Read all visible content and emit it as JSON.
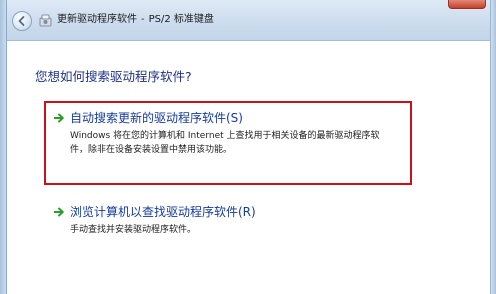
{
  "window": {
    "title_app": "更新驱动程序软件",
    "title_separator": "-",
    "title_device": "PS/2 标准键盘"
  },
  "page": {
    "question": "您想如何搜索驱动程序软件?"
  },
  "options": [
    {
      "title": "自动搜索更新的驱动程序软件(S)",
      "desc_line1": "Windows 将在您的计算机和 Internet 上查找用于相关设备的最新驱动程序软",
      "desc_line2": "件，除非在设备安装设置中禁用该功能。"
    },
    {
      "title": "浏览计算机以查找驱动程序软件(R)",
      "desc_line1": "手动查找并安装驱动程序软件。"
    }
  ],
  "colors": {
    "highlight_border": "#c8111a",
    "link_blue": "#163c9a",
    "arrow_green": "#2e9a2e"
  },
  "icons": {
    "back": "back-arrow-icon",
    "app": "device-setup-icon",
    "option_arrow": "green-arrow-icon"
  }
}
